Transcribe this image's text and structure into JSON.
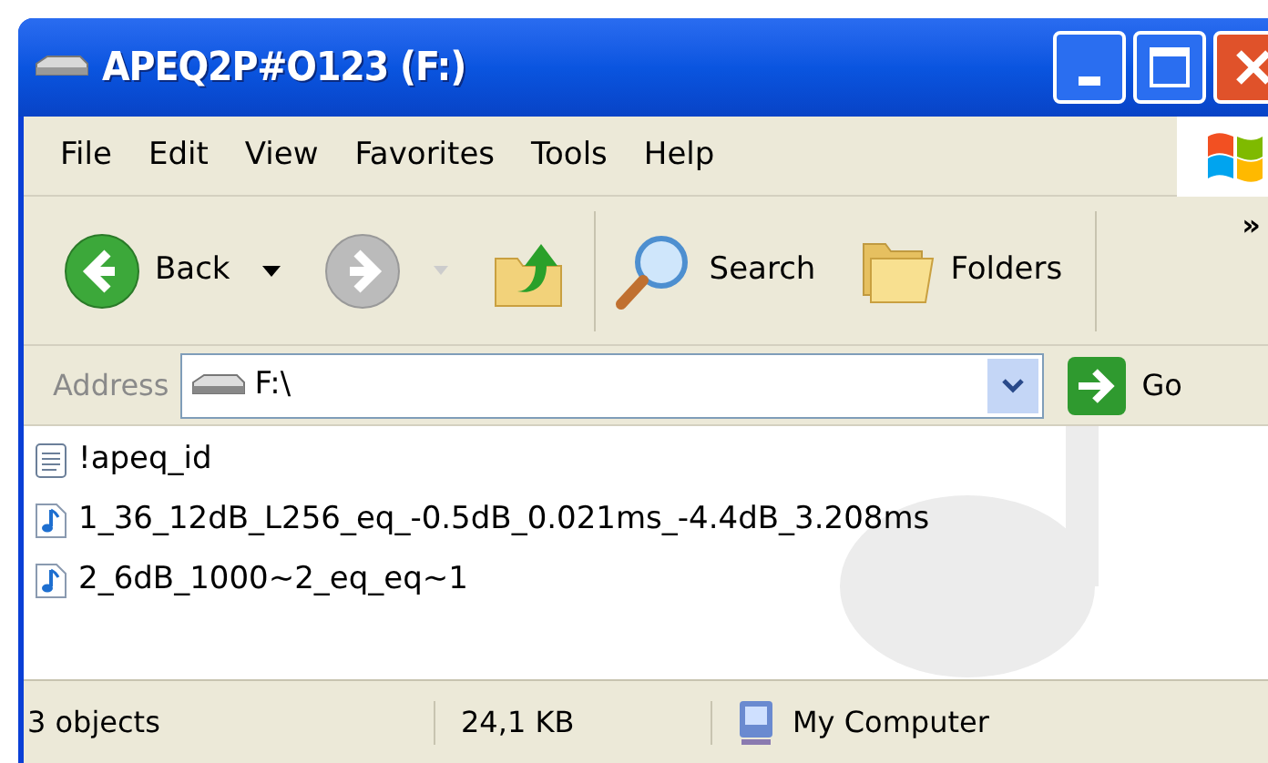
{
  "window": {
    "title": "APEQ2P#O123 (F:)"
  },
  "menu": [
    "File",
    "Edit",
    "View",
    "Favorites",
    "Tools",
    "Help"
  ],
  "toolbar": {
    "back": "Back",
    "search": "Search",
    "folders": "Folders",
    "more": "»"
  },
  "address": {
    "label": "Address",
    "value": "F:\\",
    "go": "Go"
  },
  "files": [
    {
      "name": "!apeq_id",
      "kind": "text"
    },
    {
      "name": "1_36_12dB_L256_eq_-0.5dB_0.021ms_-4.4dB_3.208ms",
      "kind": "audio"
    },
    {
      "name": "2_6dB_1000~2_eq_eq~1",
      "kind": "audio"
    }
  ],
  "status_bar": {
    "objects": "3 objects",
    "size": "24,1 KB",
    "zone": "My Computer"
  }
}
